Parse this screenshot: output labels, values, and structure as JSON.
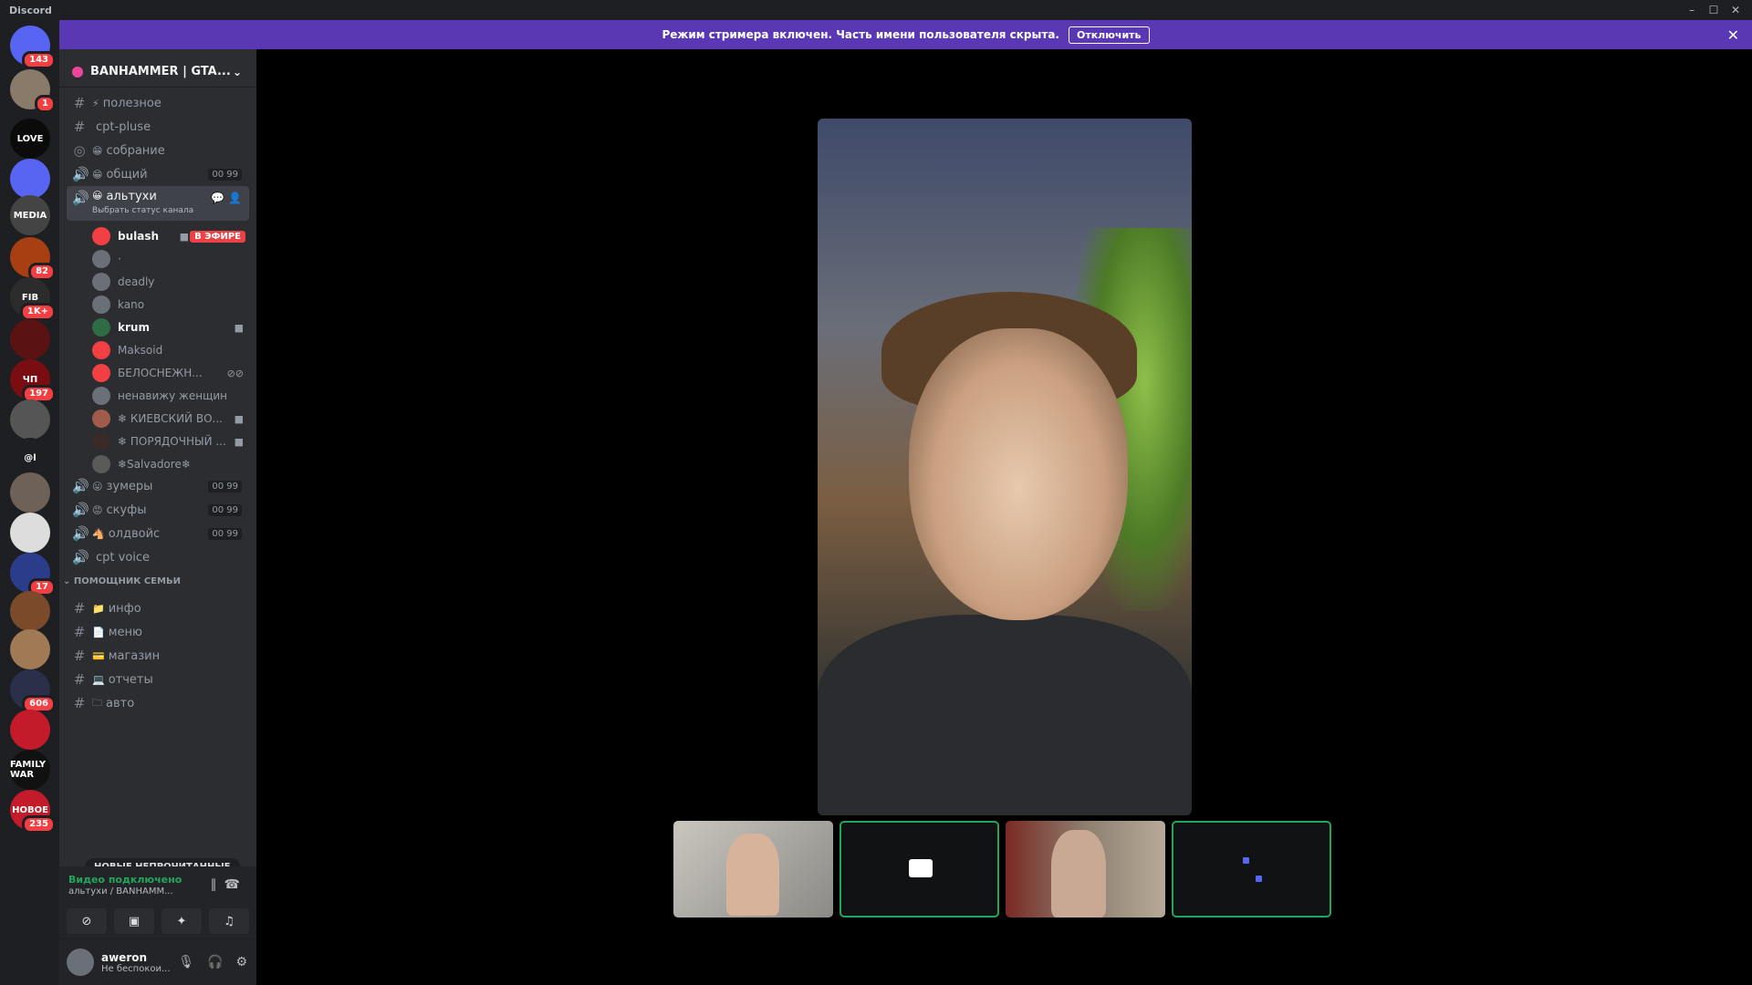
{
  "window": {
    "app_name": "Discord"
  },
  "banner": {
    "text": "Режим стримера включен. Часть имени пользователя скрыта.",
    "button": "Отключить"
  },
  "servers": [
    {
      "label": "",
      "badge": "143",
      "color": "#5865f2"
    },
    {
      "label": "",
      "badge": "1",
      "color": "#8a7a6a"
    },
    {
      "label": "LOVE",
      "badge": "",
      "color": "#0b0b0b"
    },
    {
      "label": "",
      "badge": "",
      "color": "#5865f2"
    },
    {
      "label": "MEDIA",
      "badge": "",
      "color": "#444"
    },
    {
      "label": "",
      "badge": "82",
      "color": "#a83f12"
    },
    {
      "label": "FIB",
      "badge": "1K+",
      "color": "#2c2c2c"
    },
    {
      "label": "",
      "badge": "",
      "color": "#5a1212"
    },
    {
      "label": "ЧП",
      "badge": "197",
      "color": "#7a0d12"
    },
    {
      "label": "",
      "badge": "",
      "color": "#555"
    },
    {
      "label": "@l",
      "badge": "",
      "color": "#1e1f22"
    },
    {
      "label": "",
      "badge": "",
      "color": "#6e6258"
    },
    {
      "label": "",
      "badge": "",
      "color": "#ddd"
    },
    {
      "label": "",
      "badge": "17",
      "color": "#2b3d8a"
    },
    {
      "label": "",
      "badge": "",
      "color": "#7a4a2a"
    },
    {
      "label": "",
      "badge": "",
      "color": "#a07a55"
    },
    {
      "label": "",
      "badge": "606",
      "color": "#2a2f4a"
    },
    {
      "label": "",
      "badge": "",
      "color": "#c41b2a"
    },
    {
      "label": "FAMILY WAR",
      "badge": "",
      "color": "#111"
    },
    {
      "label": "НОВОЕ",
      "badge": "235",
      "color": "#c41b2a"
    }
  ],
  "guild": {
    "name": "BANHAMMER | GTA..."
  },
  "channels": [
    {
      "emoji": "⚡",
      "name": "полезное",
      "type": "text",
      "count": ""
    },
    {
      "emoji": "",
      "name": "cpt-pluse",
      "type": "text",
      "count": ""
    },
    {
      "emoji": "😁",
      "name": "собрание",
      "type": "stage",
      "count": ""
    },
    {
      "emoji": "😁",
      "name": "общий",
      "type": "voice",
      "count": "00 99"
    }
  ],
  "active_channel": {
    "emoji": "😀",
    "name": "альтухи",
    "status": "Выбрать статус канала"
  },
  "voice_users": [
    {
      "name": "bulash",
      "bright": true,
      "live": "В ЭФИРЕ",
      "cam": true,
      "color": "#f23f43"
    },
    {
      "name": "·",
      "bright": false,
      "color": "#6b6f78"
    },
    {
      "name": "deadly",
      "bright": false,
      "color": "#6b6f78"
    },
    {
      "name": "kano",
      "bright": false,
      "color": "#6b6f78"
    },
    {
      "name": "krum",
      "bright": true,
      "cam": true,
      "color": "#2f6b44"
    },
    {
      "name": "Maksoid",
      "bright": false,
      "color": "#f23f43"
    },
    {
      "name": "БЕЛОСНЕЖН...",
      "bright": false,
      "muted": true,
      "color": "#f23f43"
    },
    {
      "name": "ненавижу женщин",
      "bright": false,
      "color": "#6b6f78"
    },
    {
      "name": "❄ КИЕВСКИЙ ВО...",
      "bright": false,
      "cam": true,
      "color": "#a15b4a"
    },
    {
      "name": "❄ ПОРЯДОЧНЫЙ ...",
      "bright": false,
      "cam": true,
      "color": "#3a2a2a"
    },
    {
      "name": "❄Salvadore❄",
      "bright": false,
      "color": "#5a5a5a"
    }
  ],
  "channels_after": [
    {
      "emoji": "😛",
      "name": "зумеры",
      "count": "00 99"
    },
    {
      "emoji": "😡",
      "name": "скуфы",
      "count": "00 99"
    },
    {
      "emoji": "🐴",
      "name": "олдвойс",
      "count": "00 99"
    },
    {
      "emoji": "",
      "name": "cpt voice",
      "count": ""
    }
  ],
  "category": {
    "name": "ПОМОЩНИК СЕМЬИ"
  },
  "category_channels": [
    {
      "emoji": "📁",
      "name": "инфо"
    },
    {
      "emoji": "📄",
      "name": "меню"
    },
    {
      "emoji": "💳",
      "name": "магазин"
    },
    {
      "emoji": "💻",
      "name": "отчеты"
    },
    {
      "emoji": "🗀",
      "name": "авто"
    }
  ],
  "new_unread": "НОВЫЕ НЕПРОЧИТАННЫЕ",
  "voice_status": {
    "title": "Видео подключено",
    "channel": "альтухи / BANHAMM..."
  },
  "user": {
    "name": "aweron",
    "status": "Не беспокои..."
  }
}
